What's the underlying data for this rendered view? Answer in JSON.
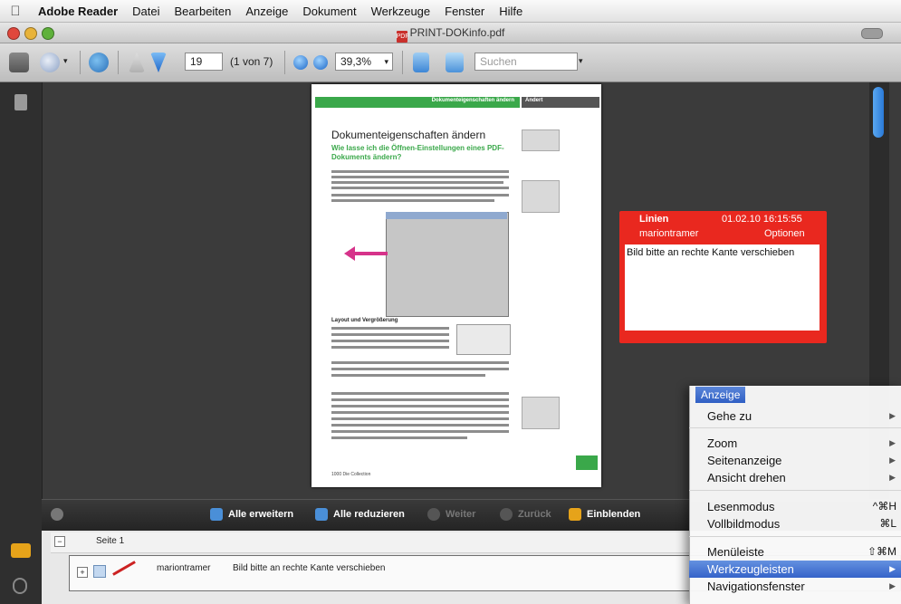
{
  "menubar": {
    "app": "Adobe Reader",
    "items": [
      "Datei",
      "Bearbeiten",
      "Anzeige",
      "Dokument",
      "Werkzeuge",
      "Fenster",
      "Hilfe"
    ]
  },
  "window": {
    "title": "PRINT-DOKinfo.pdf"
  },
  "toolbar": {
    "page_number": "19",
    "page_count": "(1 von 7)",
    "zoom": "39,3%",
    "search_placeholder": "Suchen"
  },
  "document": {
    "header_right": "Dokumenteigenschaften ändern",
    "header_tab": "Ändert",
    "title": "Dokumenteigenschaften ändern",
    "subtitle": "Wie lasse ich die Öffnen-Einstellungen eines PDF-Dokuments ändern?",
    "section": "Layout und Vergrößerung",
    "footer": "1000 Die Collection"
  },
  "note": {
    "name": "Linien",
    "date": "01.02.10 16:15:55",
    "author": "mariontramer",
    "options": "Optionen",
    "text": "Bild bitte an rechte Kante verschieben"
  },
  "comments_bar": {
    "expand_all": "Alle erweitern",
    "collapse_all": "Alle reduzieren",
    "next": "Weiter",
    "back": "Zurück",
    "show": "Einblenden"
  },
  "comments_list": {
    "page_label": "Seite 1",
    "author": "mariontramer",
    "text": "Bild bitte an rechte Kante verschieben"
  },
  "menu": {
    "title": "Anzeige",
    "items": [
      {
        "label": "Gehe zu",
        "shortcut": "",
        "submenu": true
      },
      {
        "label": "Zoom",
        "shortcut": "",
        "submenu": true
      },
      {
        "label": "Seitenanzeige",
        "shortcut": "",
        "submenu": true
      },
      {
        "label": "Ansicht drehen",
        "shortcut": "",
        "submenu": true
      },
      {
        "label": "Lesenmodus",
        "shortcut": "^⌘H",
        "submenu": false
      },
      {
        "label": "Vollbildmodus",
        "shortcut": "⌘L",
        "submenu": false
      },
      {
        "label": "Menüleiste",
        "shortcut": "⇧⌘M",
        "submenu": false
      },
      {
        "label": "Werkzeugleisten",
        "shortcut": "",
        "submenu": true,
        "selected": true
      },
      {
        "label": "Navigationsfenster",
        "shortcut": "",
        "submenu": true
      }
    ]
  },
  "colors": {
    "accent_green": "#3aa84a",
    "note_red": "#e9281f",
    "menu_selection": "#3563c9"
  }
}
